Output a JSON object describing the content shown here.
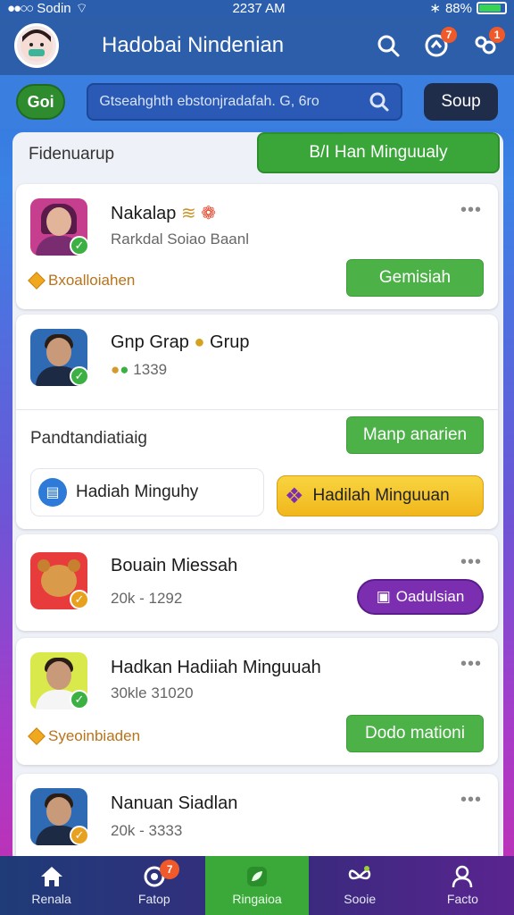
{
  "status_bar": {
    "carrier": "Sodin",
    "time": "2237 AM",
    "battery": "88%"
  },
  "header": {
    "title": "Hadobai Nindenian",
    "notif_badge": "7",
    "user_badge": "1"
  },
  "search": {
    "go_label": "Goi",
    "placeholder": "Gtseahghth ebstonjradafah. G, 6ro",
    "soup_label": "Soup"
  },
  "panel": {
    "label": "Fidenuarup",
    "weekly_button": "B/I Han Minguualy"
  },
  "cards": [
    {
      "name": "Nakalap",
      "sub": "Rarkdal Soiao Baanl",
      "coin_label": "Bxoalloiahen",
      "button": "Gemisiah"
    },
    {
      "name": "Gnp Grap",
      "name2": "Grup",
      "sub": "1339"
    },
    {
      "name": "Bouain Miessah",
      "sub": "20k - 1292",
      "button": "Oadulsian"
    },
    {
      "name": "Hadkan Hadiiah Minguuah",
      "sub": "30kle 31020",
      "coin_label": "Syeoinbiaden",
      "button": "Dodo mationi"
    },
    {
      "name": "Nanuan Siadlan",
      "sub": "20k - 3333"
    }
  ],
  "section": {
    "title": "Pandtandiatiaig",
    "button": "Manp anarien",
    "gift_left": "Hadiah Minguhy",
    "gift_right": "Hadilah Minguuan"
  },
  "nav": [
    {
      "label": "Renala",
      "icon": "home-icon"
    },
    {
      "label": "Fatop",
      "icon": "circle-icon",
      "badge": "7"
    },
    {
      "label": "Ringaioa",
      "icon": "leaf-icon"
    },
    {
      "label": "Sooie",
      "icon": "butterfly-icon"
    },
    {
      "label": "Facto",
      "icon": "person-icon"
    }
  ],
  "colors": {
    "accent_green": "#3aa63a",
    "header_blue": "#2c5ea9",
    "badge_orange": "#f05a2a",
    "purple": "#7b2fb0"
  }
}
